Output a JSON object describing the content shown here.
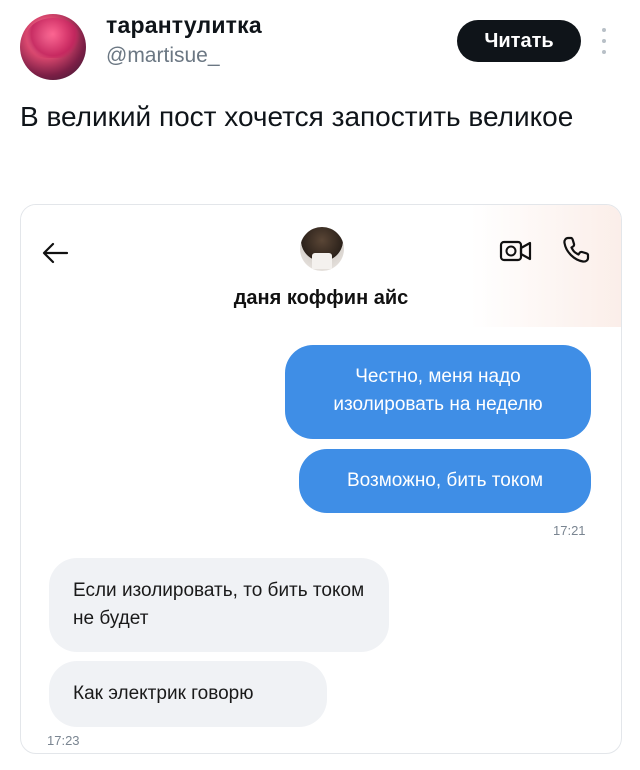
{
  "tweet": {
    "author_name": "тарантулитка",
    "author_handle": "@martisue_",
    "follow_label": "Читать",
    "text": "В великий пост хочется запостить великое"
  },
  "chat": {
    "contact_name": "даня коффин айс",
    "messages_out": [
      {
        "text": "Честно, меня надо изолировать на неделю"
      },
      {
        "text": "Возможно, бить током"
      }
    ],
    "time_out": "17:21",
    "messages_in": [
      {
        "text": "Если изолировать, то бить током не будет"
      },
      {
        "text": "Как электрик говорю"
      }
    ],
    "time_in": "17:23"
  },
  "colors": {
    "outgoing_bubble": "#3f8ee6",
    "incoming_bubble": "#f0f2f5",
    "follow_button": "#0f1419"
  },
  "icons": [
    "back-arrow-icon",
    "video-call-icon",
    "phone-icon",
    "more-vertical-icon"
  ]
}
